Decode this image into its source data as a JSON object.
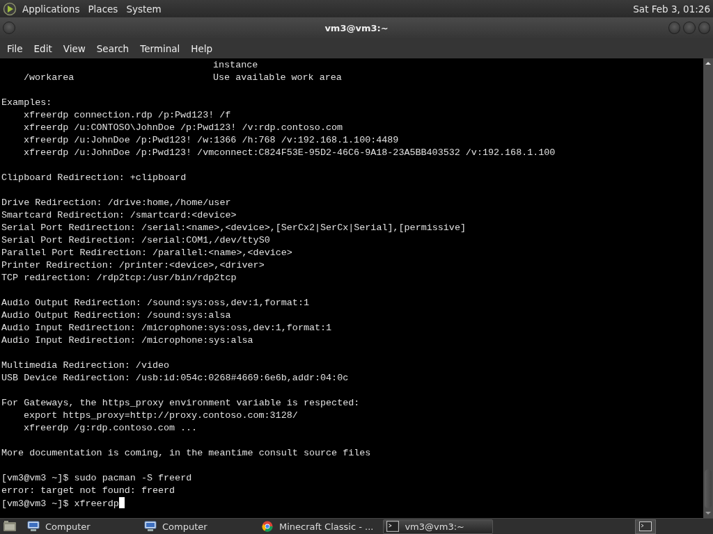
{
  "top_panel": {
    "menus": [
      "Applications",
      "Places",
      "System"
    ],
    "clock": "Sat Feb 3, 01:26"
  },
  "window": {
    "title": "vm3@vm3:~"
  },
  "menu_bar": [
    "File",
    "Edit",
    "View",
    "Search",
    "Terminal",
    "Help"
  ],
  "terminal": {
    "options": [
      {
        "description": "instance"
      },
      {
        "option": "/workarea",
        "description": "Use available work area"
      }
    ],
    "blocks": [
      [
        {
          "kind": "plain",
          "text": "Examples:"
        },
        {
          "kind": "indented",
          "text": "xfreerdp connection.rdp /p:Pwd123! /f"
        },
        {
          "kind": "indented",
          "text": "xfreerdp /u:CONTOSO\\JohnDoe /p:Pwd123! /v:rdp.contoso.com"
        },
        {
          "kind": "indented",
          "text": "xfreerdp /u:JohnDoe /p:Pwd123! /w:1366 /h:768 /v:192.168.1.100:4489"
        },
        {
          "kind": "indented",
          "text": "xfreerdp /u:JohnDoe /p:Pwd123! /vmconnect:C824F53E-95D2-46C6-9A18-23A5BB403532 /v:192.168.1.100"
        }
      ],
      [
        {
          "kind": "plain",
          "text": "Clipboard Redirection: +clipboard"
        }
      ],
      [
        {
          "kind": "plain",
          "text": "Drive Redirection: /drive:home,/home/user"
        },
        {
          "kind": "plain",
          "text": "Smartcard Redirection: /smartcard:<device>"
        },
        {
          "kind": "plain",
          "text": "Serial Port Redirection: /serial:<name>,<device>,[SerCx2|SerCx|Serial],[permissive]"
        },
        {
          "kind": "plain",
          "text": "Serial Port Redirection: /serial:COM1,/dev/ttyS0"
        },
        {
          "kind": "plain",
          "text": "Parallel Port Redirection: /parallel:<name>,<device>"
        },
        {
          "kind": "plain",
          "text": "Printer Redirection: /printer:<device>,<driver>"
        },
        {
          "kind": "plain",
          "text": "TCP redirection: /rdp2tcp:/usr/bin/rdp2tcp"
        }
      ],
      [
        {
          "kind": "plain",
          "text": "Audio Output Redirection: /sound:sys:oss,dev:1,format:1"
        },
        {
          "kind": "plain",
          "text": "Audio Output Redirection: /sound:sys:alsa"
        },
        {
          "kind": "plain",
          "text": "Audio Input Redirection: /microphone:sys:oss,dev:1,format:1"
        },
        {
          "kind": "plain",
          "text": "Audio Input Redirection: /microphone:sys:alsa"
        }
      ],
      [
        {
          "kind": "plain",
          "text": "Multimedia Redirection: /video"
        },
        {
          "kind": "plain",
          "text": "USB Device Redirection: /usb:id:054c:0268#4669:6e6b,addr:04:0c"
        }
      ],
      [
        {
          "kind": "plain",
          "text": "For Gateways, the https_proxy environment variable is respected:"
        },
        {
          "kind": "indented",
          "text": "export https_proxy=http://proxy.contoso.com:3128/"
        },
        {
          "kind": "indented",
          "text": "xfreerdp /g:rdp.contoso.com ..."
        }
      ],
      [
        {
          "kind": "plain",
          "text": "More documentation is coming, in the meantime consult source files"
        }
      ],
      [
        {
          "kind": "plain",
          "text": "[vm3@vm3 ~]$ sudo pacman -S freerd"
        },
        {
          "kind": "plain",
          "text": "error: target not found: freerd"
        },
        {
          "kind": "prompt",
          "text": "[vm3@vm3 ~]$ xfreerdp"
        }
      ]
    ]
  },
  "taskbar": [
    {
      "kind": "computer",
      "label": "Computer",
      "selected": false
    },
    {
      "kind": "computer",
      "label": "Computer",
      "selected": false
    },
    {
      "kind": "browser",
      "label": "Minecraft Classic - ...",
      "selected": false
    },
    {
      "kind": "terminal",
      "label": "vm3@vm3:~",
      "selected": true
    }
  ]
}
